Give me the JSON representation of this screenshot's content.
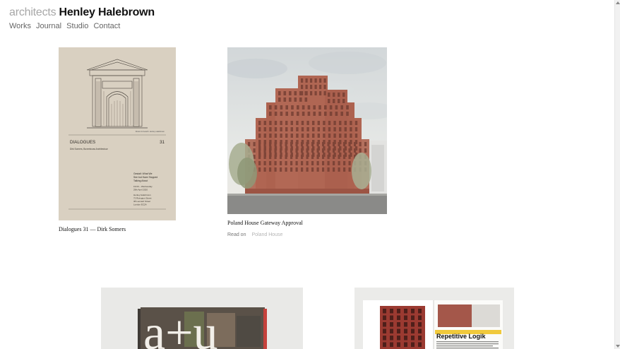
{
  "header": {
    "logo_prefix": "architects",
    "logo_name": "Henley Halebrown",
    "nav": [
      "Works",
      "Journal",
      "Studio",
      "Contact"
    ]
  },
  "posts": [
    {
      "caption": "Dialogues 31 — Dirk Somers",
      "poster": {
        "title": "DIALOGUES",
        "number": "31",
        "subtitle": "Dirk Somers, Bovenbouw Architectuur",
        "talk": [
          "Gestalt: What We",
          "See but Have Stopped",
          "Talking About"
        ],
        "date": [
          "19:00 – Wednesday",
          "29th April 2020"
        ],
        "venue": [
          "Henley Halebrown",
          "72 Rivington Street",
          "38 Leonard Street",
          "London EC2A"
        ],
        "credit": "Drawn & Gareth: Henley Halebrown"
      }
    },
    {
      "caption": "Poland House Gateway Approval",
      "read_on_label": "Read on",
      "read_on_link": "Poland House"
    },
    {
      "magazine_mark": "a+u"
    },
    {
      "heading": "Repetitive Logik"
    }
  ],
  "colors": {
    "logo_light": "#a7a7a7",
    "poster_bg": "#d9d0c1",
    "brick": "#b06552",
    "sky": "#dfe3e3"
  }
}
